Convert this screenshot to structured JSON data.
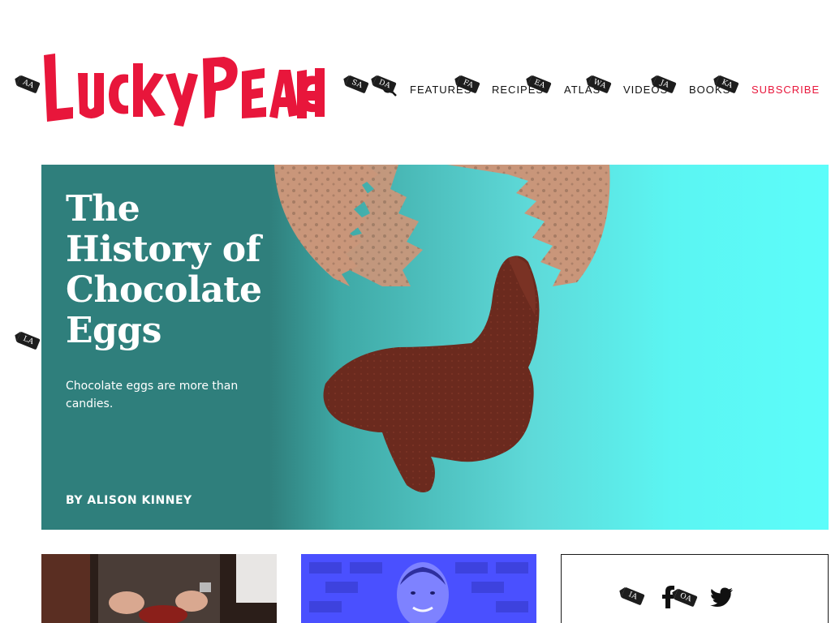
{
  "header": {
    "logo_text": "LUCKY PEACH",
    "nav": [
      {
        "label": "FEATURES"
      },
      {
        "label": "RECIPES"
      },
      {
        "label": "ATLAS"
      },
      {
        "label": "VIDEOS"
      },
      {
        "label": "BOOKS"
      },
      {
        "label": "SUBSCRIBE"
      }
    ]
  },
  "hints": {
    "logo": "AA",
    "search_before": "SA",
    "search": "DA",
    "features": "FA",
    "recipes": "EA",
    "atlas": "WA",
    "videos": "JA",
    "books": "KA",
    "hero": "LA",
    "social_1": "IA",
    "social_2": "OA"
  },
  "hero": {
    "title": "The History of Chocolate Eggs",
    "dek": "Chocolate eggs are more than candies.",
    "byline": "BY ALISON KINNEY"
  },
  "colors": {
    "brand_red": "#e8163b",
    "hero_dark": "#2f7f7c",
    "hero_light": "#5cfdfa",
    "chocolate": "#6b2a1e",
    "eggshell": "#c9967a"
  },
  "icons": [
    "search-icon",
    "facebook-icon",
    "twitter-icon"
  ]
}
